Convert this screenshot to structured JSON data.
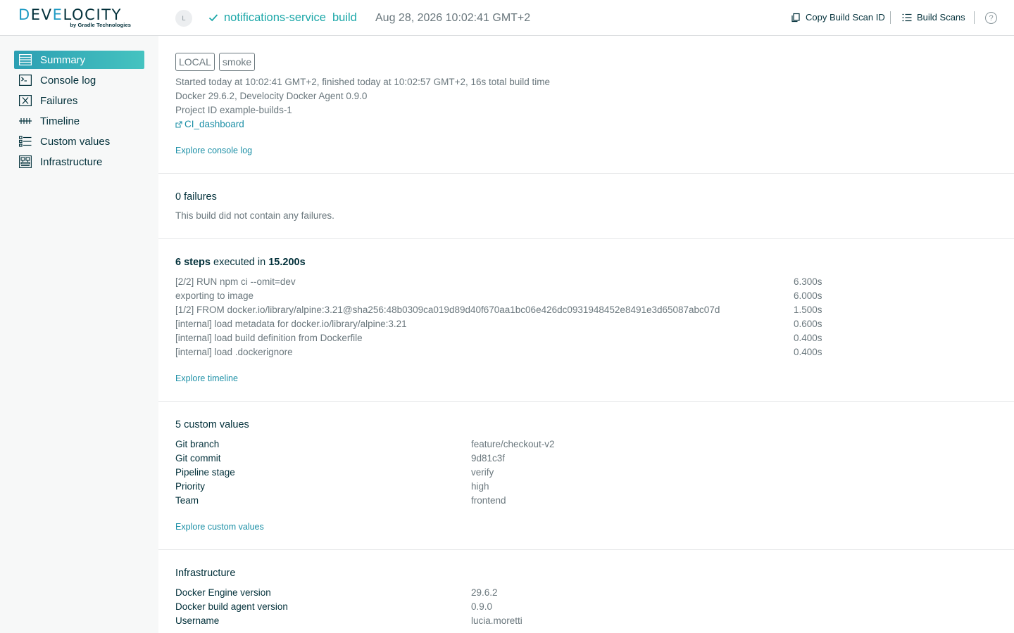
{
  "header": {
    "logo_text": "DEVELOCITY",
    "logo_sub": "by Gradle Technologies",
    "avatar_letter": "L",
    "project": "notifications-service",
    "task": "build",
    "date": "Aug 28, 2026 10:02:41 GMT+2",
    "copy_label": "Copy Build Scan ID",
    "scans_label": "Build Scans",
    "help_glyph": "?"
  },
  "sidebar": {
    "items": [
      {
        "label": "Summary",
        "icon": "summary-icon"
      },
      {
        "label": "Console log",
        "icon": "console-icon"
      },
      {
        "label": "Failures",
        "icon": "failures-icon"
      },
      {
        "label": "Timeline",
        "icon": "timeline-icon"
      },
      {
        "label": "Custom values",
        "icon": "custom-values-icon"
      },
      {
        "label": "Infrastructure",
        "icon": "infrastructure-icon"
      }
    ]
  },
  "summary": {
    "tags": [
      "LOCAL",
      "smoke"
    ],
    "started": "Started today at 10:02:41 GMT+2, finished today at 10:02:57 GMT+2, 16s total build time",
    "agent": "Docker 29.6.2, Develocity Docker Agent 0.9.0",
    "project_id": "Project ID example-builds-1",
    "ci_link": "CI_dashboard",
    "explore": "Explore console log"
  },
  "failures": {
    "title": "0 failures",
    "text": "This build did not contain any failures."
  },
  "steps": {
    "count": "6 steps",
    "executed_in": "executed in",
    "total": "15.200s",
    "rows": [
      {
        "name": "[2/2] RUN npm ci --omit=dev",
        "duration": "6.300s"
      },
      {
        "name": "exporting to image",
        "duration": "6.000s"
      },
      {
        "name": "[1/2] FROM docker.io/library/alpine:3.21@sha256:48b0309ca019d89d40f670aa1bc06e426dc0931948452e8491e3d65087abc07d",
        "duration": "1.500s"
      },
      {
        "name": "[internal] load metadata for docker.io/library/alpine:3.21",
        "duration": "0.600s"
      },
      {
        "name": "[internal] load build definition from Dockerfile",
        "duration": "0.400s"
      },
      {
        "name": "[internal] load .dockerignore",
        "duration": "0.400s"
      }
    ],
    "explore": "Explore timeline"
  },
  "custom_values": {
    "title": "5 custom values",
    "rows": [
      {
        "key": "Git branch",
        "value": "feature/checkout-v2"
      },
      {
        "key": "Git commit",
        "value": "9d81c3f"
      },
      {
        "key": "Pipeline stage",
        "value": "verify"
      },
      {
        "key": "Priority",
        "value": "high"
      },
      {
        "key": "Team",
        "value": "frontend"
      }
    ],
    "explore": "Explore custom values"
  },
  "infrastructure": {
    "title": "Infrastructure",
    "rows": [
      {
        "key": "Docker Engine version",
        "value": "29.6.2"
      },
      {
        "key": "Docker build agent version",
        "value": "0.9.0"
      },
      {
        "key": "Username",
        "value": "lucia.moretti"
      }
    ]
  },
  "colors": {
    "accent": "#1ba7a8",
    "link": "#1b8fa6",
    "text": "#02303a",
    "muted": "#6a777d"
  }
}
